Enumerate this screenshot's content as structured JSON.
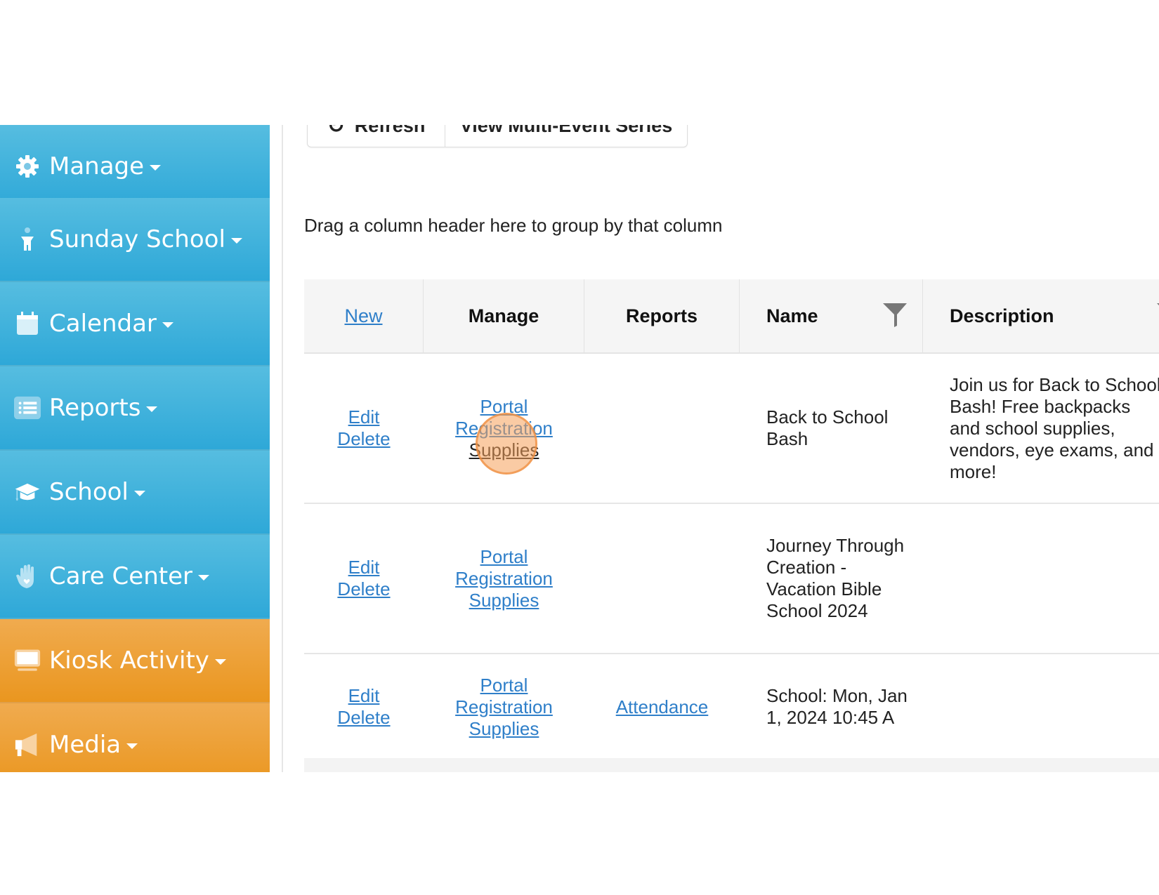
{
  "sidebar": {
    "items": [
      {
        "label": "Manage",
        "icon": "gear-icon",
        "color": "#3fb0dc"
      },
      {
        "label": "Sunday School",
        "icon": "child-icon",
        "color": "#3fb0dc"
      },
      {
        "label": "Calendar",
        "icon": "calendar-icon",
        "color": "#3fb0dc"
      },
      {
        "label": "Reports",
        "icon": "list-icon",
        "color": "#3fb0dc"
      },
      {
        "label": "School",
        "icon": "graduation-cap-icon",
        "color": "#3fb0dc"
      },
      {
        "label": "Care Center",
        "icon": "hand-heart-icon",
        "color": "#3fb0dc"
      },
      {
        "label": "Kiosk Activity",
        "icon": "monitor-icon",
        "color": "#eda035"
      },
      {
        "label": "Media",
        "icon": "megaphone-icon",
        "color": "#eda035"
      }
    ]
  },
  "toolbar": {
    "refresh_label": "Refresh",
    "multi_event_label": "View Multi-Event Series"
  },
  "grid": {
    "group_hint": "Drag a column header here to group by that column",
    "columns": {
      "new": "New",
      "manage": "Manage",
      "reports": "Reports",
      "name": "Name",
      "description": "Description"
    },
    "rows": [
      {
        "edit": "Edit",
        "delete": "Delete",
        "portal": "Portal",
        "registration": "Registration",
        "supplies": "Supplies",
        "report": "",
        "name": "Back to School Bash",
        "description": "Join us for Back to School Bash! Free backpacks and school supplies, vendors, eye exams, and more!"
      },
      {
        "edit": "Edit",
        "delete": "Delete",
        "portal": "Portal",
        "registration": "Registration",
        "supplies": "Supplies",
        "report": "",
        "name": "Journey Through Creation - Vacation Bible School 2024",
        "description": ""
      },
      {
        "edit": "Edit",
        "delete": "Delete",
        "portal": "Portal",
        "registration": "Registration",
        "supplies": "Supplies",
        "report": "Attendance",
        "name": "School: Mon, Jan 1, 2024 10:45 A",
        "description": ""
      }
    ]
  },
  "colors": {
    "sidebar_blue": "#3fb0dc",
    "sidebar_orange": "#eda035",
    "link": "#2f7fc9",
    "click_indicator": "#f5a05a"
  }
}
